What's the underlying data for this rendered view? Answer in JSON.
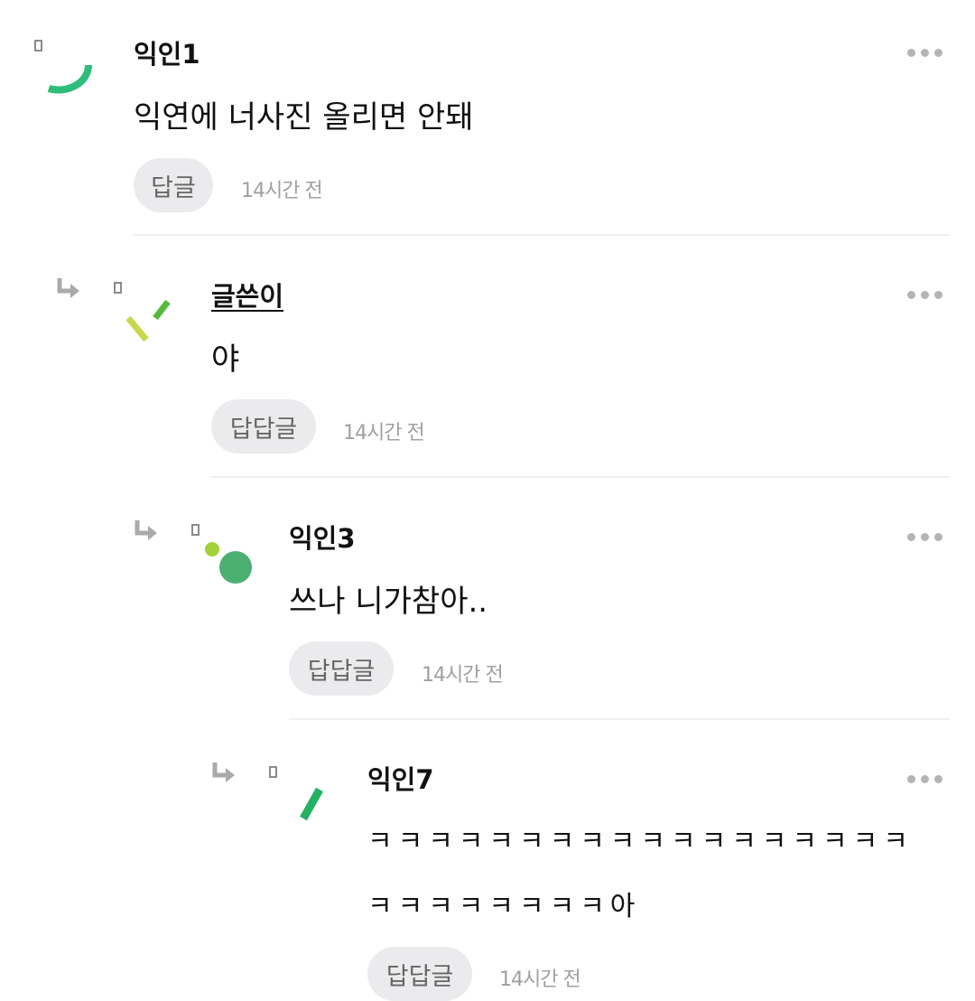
{
  "comments": [
    {
      "nickname": "익인1",
      "text": "익연에 너사진 올리면 안돼",
      "reply_label": "답글",
      "time": "14시간 전"
    },
    {
      "nickname": "글쓴이",
      "text": "야",
      "reply_label": "답답글",
      "time": "14시간 전"
    },
    {
      "nickname": "익인3",
      "text": "쓰나 니가참아..",
      "reply_label": "답답글",
      "time": "14시간 전"
    },
    {
      "nickname": "익인7",
      "text_line1": "ㅋㅋㅋㅋㅋㅋㅋㅋㅋㅋㅋㅋㅋㅋㅋㅋㅋㅋ",
      "text_line2": "ㅋㅋㅋㅋㅋㅋㅋㅋ아",
      "reply_label": "답답글",
      "time": "14시간 전"
    }
  ],
  "icons": {
    "more": "more-options-icon",
    "reply_arrow": "reply-arrow-icon",
    "badge": "level-badge-icon"
  },
  "colors": {
    "avatar_green": "#2ebd7a",
    "avatar_lime": "#c9d84a",
    "button_bg": "#ebebed",
    "time_gray": "#a0a0a0"
  }
}
